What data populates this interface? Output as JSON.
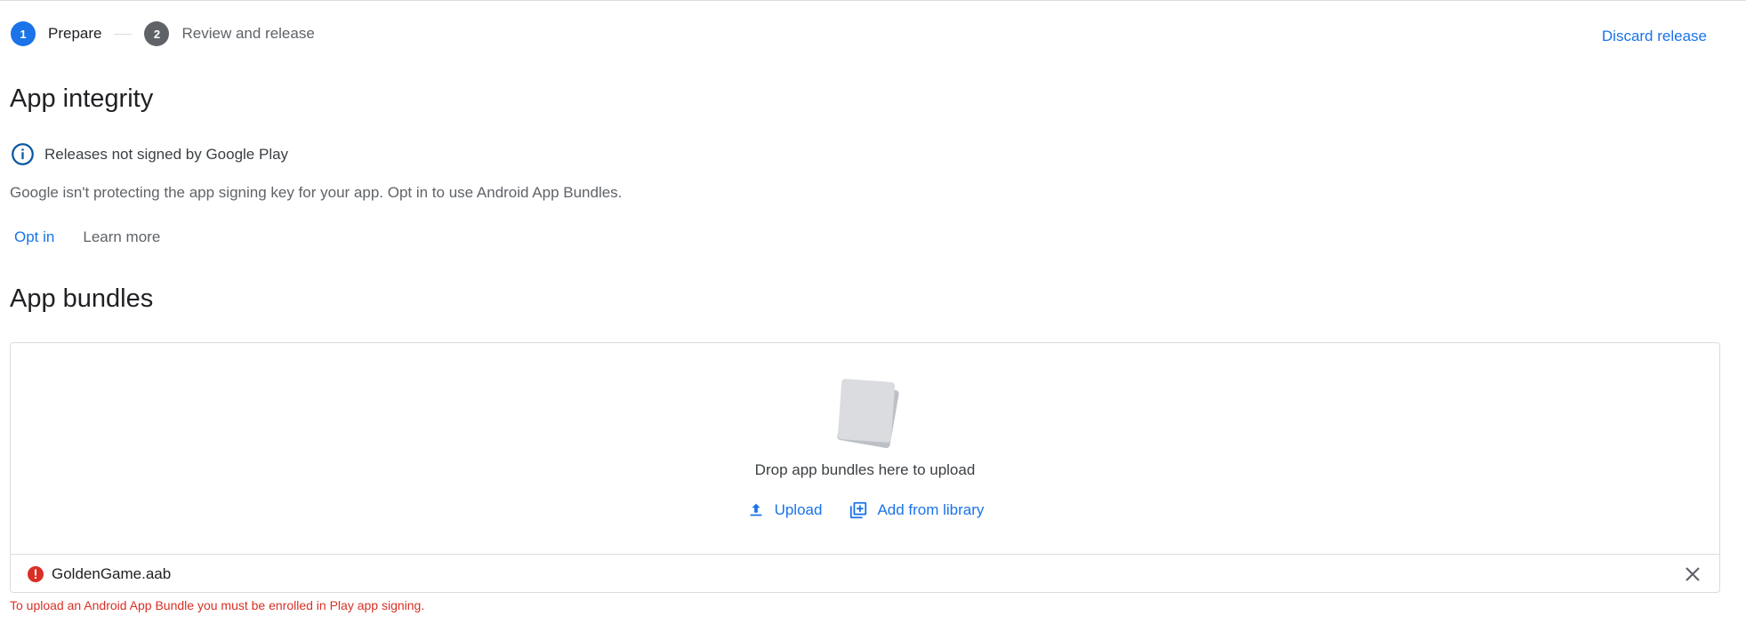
{
  "stepper": {
    "steps": [
      {
        "number": "1",
        "label": "Prepare"
      },
      {
        "number": "2",
        "label": "Review and release"
      }
    ]
  },
  "header": {
    "discard_label": "Discard release"
  },
  "integrity": {
    "title": "App integrity",
    "notice": "Releases not signed by Google Play",
    "description": "Google isn't protecting the app signing key for your app. Opt in to use Android App Bundles.",
    "opt_in_label": "Opt in",
    "learn_more_label": "Learn more"
  },
  "bundles": {
    "title": "App bundles",
    "drop_text": "Drop app bundles here to upload",
    "upload_label": "Upload",
    "library_label": "Add from library",
    "file_name": "GoldenGame.aab",
    "error_text": "To upload an Android App Bundle you must be enrolled in Play app signing."
  },
  "icons": {
    "info": "info-icon",
    "upload": "upload-icon",
    "library": "library-add-icon",
    "error": "error-icon",
    "close": "close-icon",
    "drop_art": "stacked-pages-icon"
  },
  "colors": {
    "accent": "#1a73e8",
    "error": "#d93025",
    "muted": "#5f6368",
    "border": "#dadce0"
  }
}
